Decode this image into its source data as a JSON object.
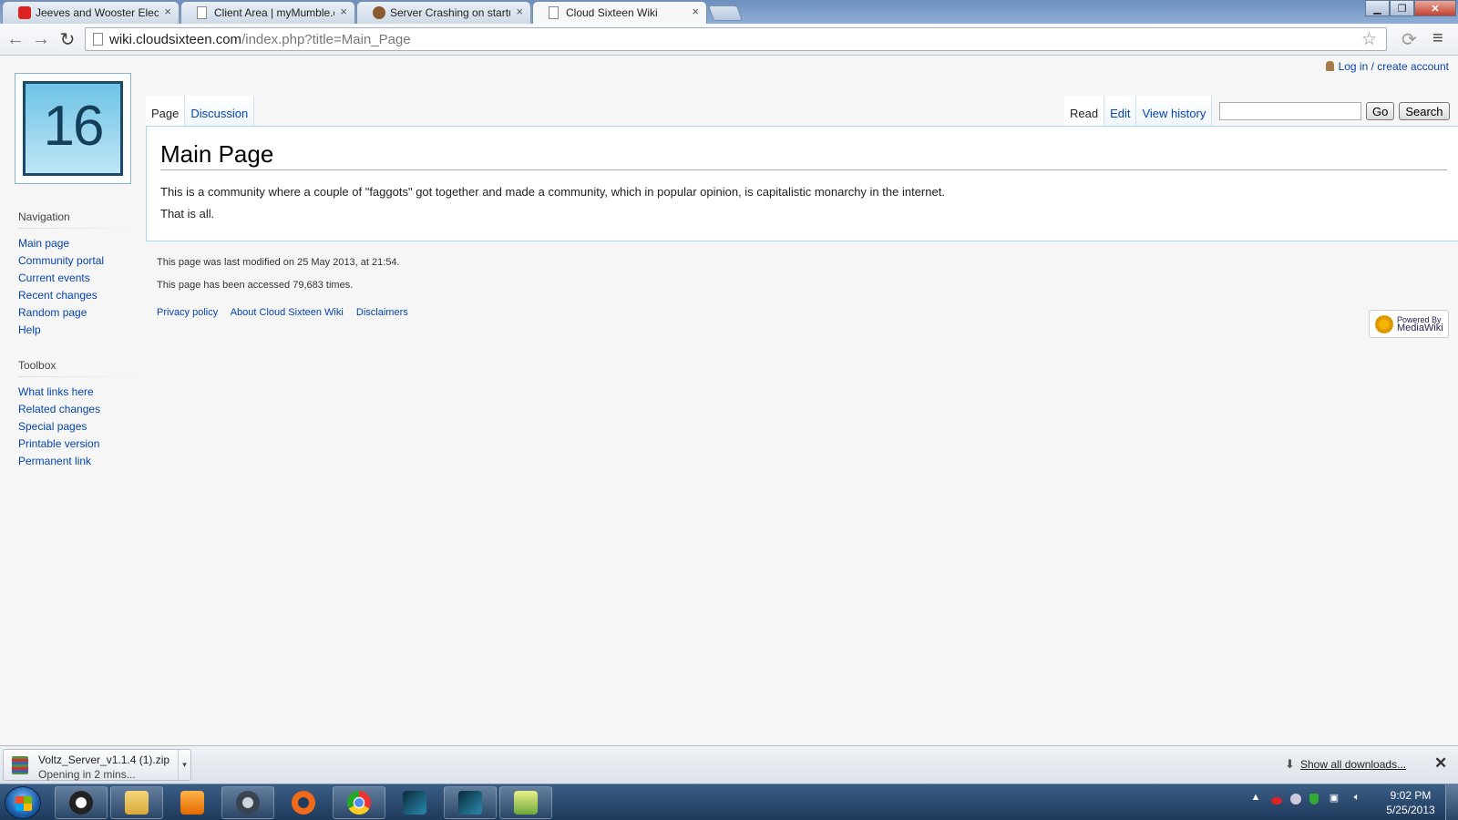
{
  "browser": {
    "tabs": [
      {
        "title": "Jeeves and Wooster Electr",
        "icon": "youtube-icon"
      },
      {
        "title": "Client Area | myMumble.c",
        "icon": "page-icon"
      },
      {
        "title": "Server Crashing on startup",
        "icon": "forum-icon"
      },
      {
        "title": "Cloud Sixteen Wiki",
        "icon": "page-icon"
      }
    ],
    "tab_close": "×",
    "url_host": "wiki.cloudsixteen.com",
    "url_path": "/index.php?title=Main_Page"
  },
  "wiki": {
    "logo_text": "16",
    "user_link": "Log in / create account",
    "tabs_left": [
      "Page",
      "Discussion"
    ],
    "tabs_right": [
      "Read",
      "Edit",
      "View history"
    ],
    "search": {
      "placeholder": "",
      "go_label": "Go",
      "search_label": "Search"
    },
    "title": "Main Page",
    "body": [
      "This is a community where a couple of \"faggots\" got together and made a community, which in popular opinion, is capitalistic monarchy in the internet.",
      "That is all."
    ],
    "navigation": {
      "heading": "Navigation",
      "items": [
        "Main page",
        "Community portal",
        "Current events",
        "Recent changes",
        "Random page",
        "Help"
      ]
    },
    "toolbox": {
      "heading": "Toolbox",
      "items": [
        "What links here",
        "Related changes",
        "Special pages",
        "Printable version",
        "Permanent link"
      ]
    },
    "footer": {
      "last_modified": "This page was last modified on 25 May 2013, at 21:54.",
      "accessed": "This page has been accessed 79,683 times.",
      "links": [
        "Privacy policy",
        "About Cloud Sixteen Wiki",
        "Disclaimers"
      ]
    },
    "powered_by": {
      "small": "Powered By",
      "large": "MediaWiki"
    }
  },
  "downloads": {
    "file_name": "Voltz_Server_v1.1.4 (1).zip",
    "status": "Opening in 2 mins...",
    "show_all": "Show all downloads...",
    "close": "✕"
  },
  "taskbar": {
    "time": "9:02 PM",
    "date": "5/25/2013"
  },
  "colors": {
    "link": "#0645ad",
    "content_border": "#a7d7f9",
    "taskbar": "#1e3a5c"
  }
}
